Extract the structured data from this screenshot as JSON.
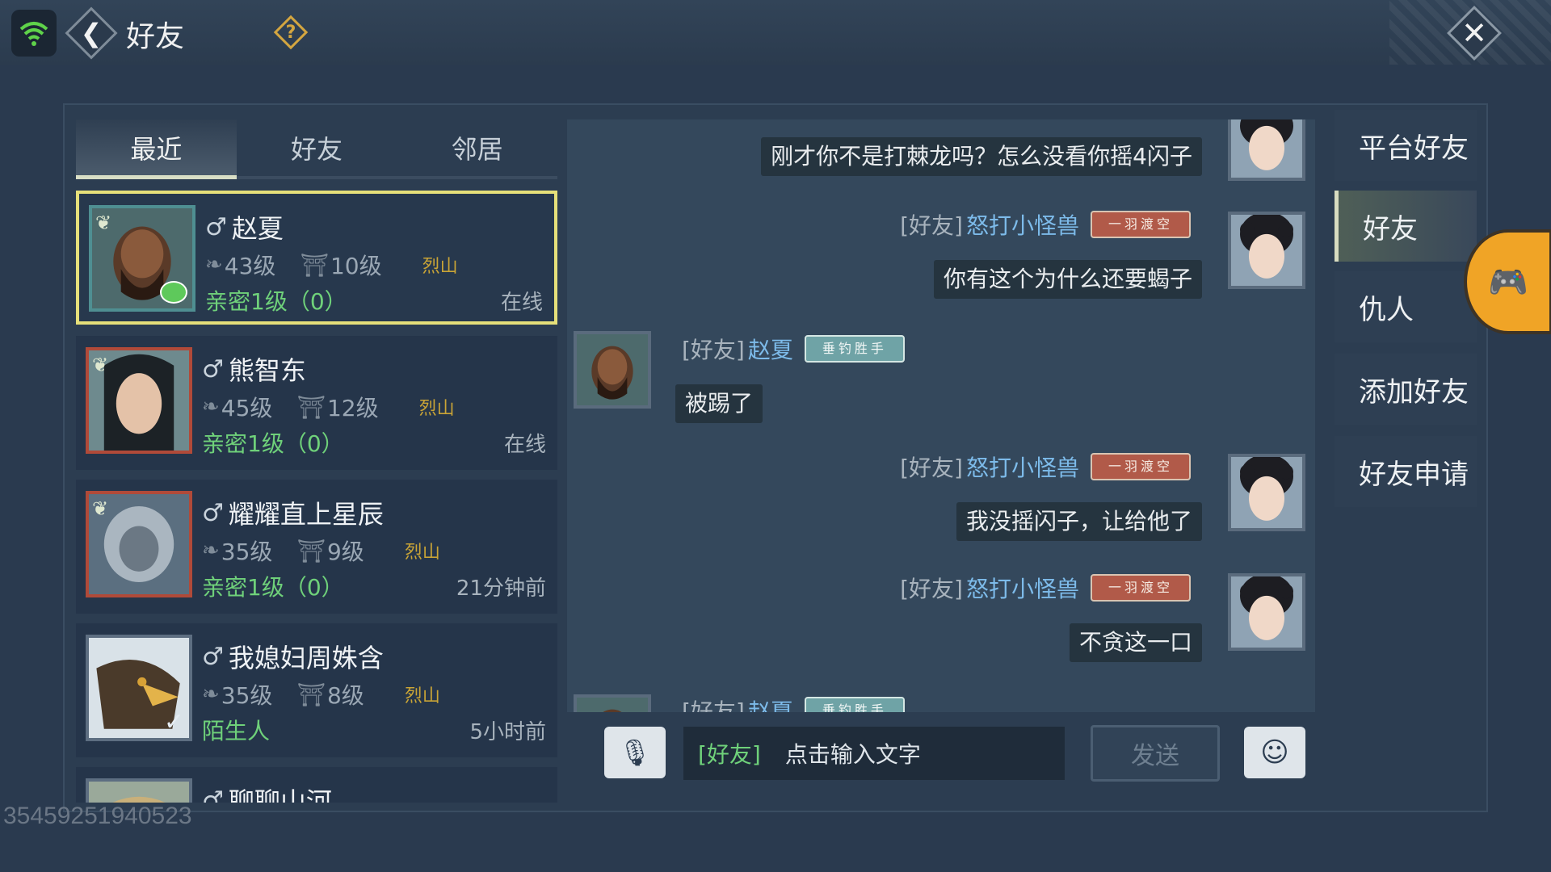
{
  "header": {
    "title": "好友",
    "back_icon": "chevron-left-icon",
    "help_icon": "question-icon",
    "close_icon": "close-icon",
    "wifi_icon": "wifi-icon",
    "colors": {
      "accent_gold": "#d4a640",
      "selected_border": "#e6e07a",
      "intimacy_green": "#6fd17a",
      "name_blue": "#7dbbea"
    }
  },
  "list_tabs": [
    {
      "label": "最近",
      "active": true
    },
    {
      "label": "好友",
      "active": false
    },
    {
      "label": "邻居",
      "active": false
    }
  ],
  "friends": [
    {
      "gender": "♂",
      "name": "赵夏",
      "level": "43级",
      "house": "10级",
      "faction": "烈山",
      "intimacy": "亲密1级（0）",
      "status": "在线",
      "selected": true
    },
    {
      "gender": "♂",
      "name": "熊智东",
      "level": "45级",
      "house": "12级",
      "faction": "烈山",
      "intimacy": "亲密1级（0）",
      "status": "在线",
      "selected": false
    },
    {
      "gender": "♂",
      "name": "耀耀直上星辰",
      "level": "35级",
      "house": "9级",
      "faction": "烈山",
      "intimacy": "亲密1级（0）",
      "status": "21分钟前",
      "selected": false
    },
    {
      "gender": "♂",
      "name": "我媳妇周姝含",
      "level": "35级",
      "house": "8级",
      "faction": "烈山",
      "intimacy": "陌生人",
      "status": "5小时前",
      "selected": false
    },
    {
      "gender": "♂",
      "name": "聊聊山河"
    }
  ],
  "chat": {
    "messages": [
      {
        "text": "刚才你不是打棘龙吗？怎么没看你摇4闪子"
      },
      {
        "tag": "[好友]",
        "sender": "怒打小怪兽",
        "badge": "一羽渡空",
        "text": "你有这个为什么还要蝎子"
      },
      {
        "tag": "[好友]",
        "sender": "赵夏",
        "badge": "垂钓胜手",
        "text": "被踢了"
      },
      {
        "tag": "[好友]",
        "sender": "怒打小怪兽",
        "badge": "一羽渡空",
        "text": "我没摇闪子，让给他了"
      },
      {
        "tag": "[好友]",
        "sender": "怒打小怪兽",
        "badge": "一羽渡空",
        "text": "不贪这一口"
      },
      {
        "tag": "[好友]",
        "sender": "赵夏",
        "badge": "垂钓胜手"
      }
    ]
  },
  "input": {
    "channel": "[好友]",
    "placeholder": "点击输入文字",
    "send_label": "发送",
    "voice_icon": "microphone-icon",
    "emoji_icon": "emoji-icon"
  },
  "side_tabs": [
    {
      "label": "平台好友",
      "active": false
    },
    {
      "label": "好友",
      "active": true
    },
    {
      "label": "仇人",
      "active": false
    },
    {
      "label": "添加好友",
      "active": false
    },
    {
      "label": "好友申请",
      "active": false
    }
  ],
  "watermark": "35459251940523"
}
